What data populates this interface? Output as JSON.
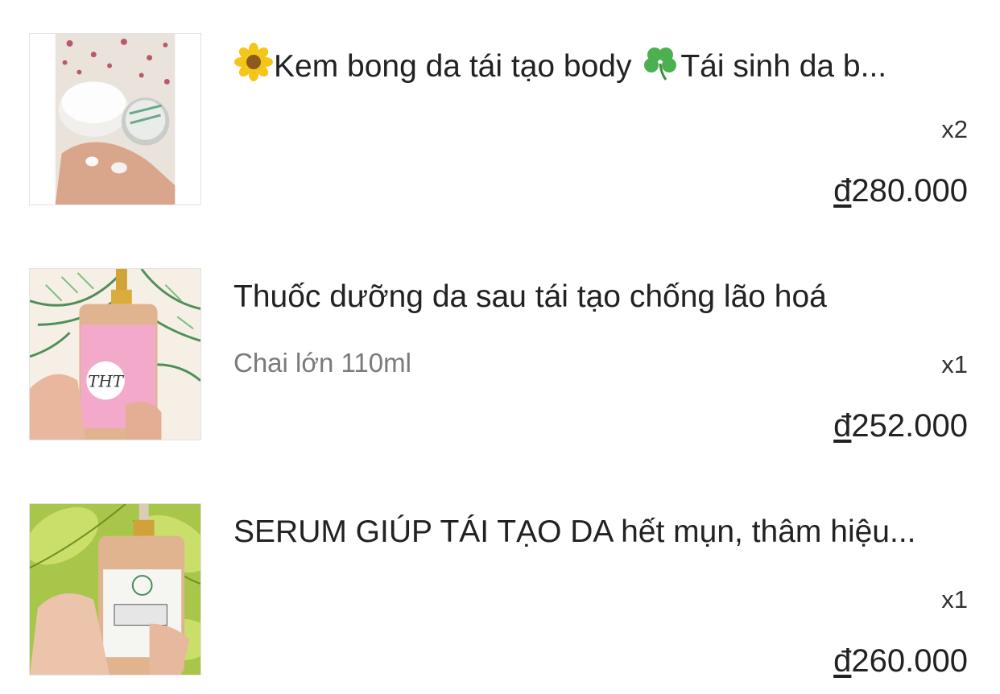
{
  "order_items": [
    {
      "title": "Kem bong da tái tạo body",
      "title_suffix": "Tái sinh da b...",
      "title_emojis": [
        "sunflower-emoji",
        "shamrock-emoji"
      ],
      "variant": "",
      "quantity": "x2",
      "currency": "đ",
      "price": "280.000",
      "image": "body-cream-jar-photo"
    },
    {
      "title": "Thuốc dưỡng da sau tái tạo chống lão hoá",
      "variant": "Chai lớn 110ml",
      "quantity": "x1",
      "currency": "đ",
      "price": "252.000",
      "image": "pink-serum-bottle-photo"
    },
    {
      "title": "SERUM GIÚP TÁI TẠO DA hết mụn, thâm hiệu...",
      "variant": "",
      "quantity": "x1",
      "currency": "đ",
      "price": "260.000",
      "image": "green-leaf-serum-bottle-photo"
    }
  ]
}
